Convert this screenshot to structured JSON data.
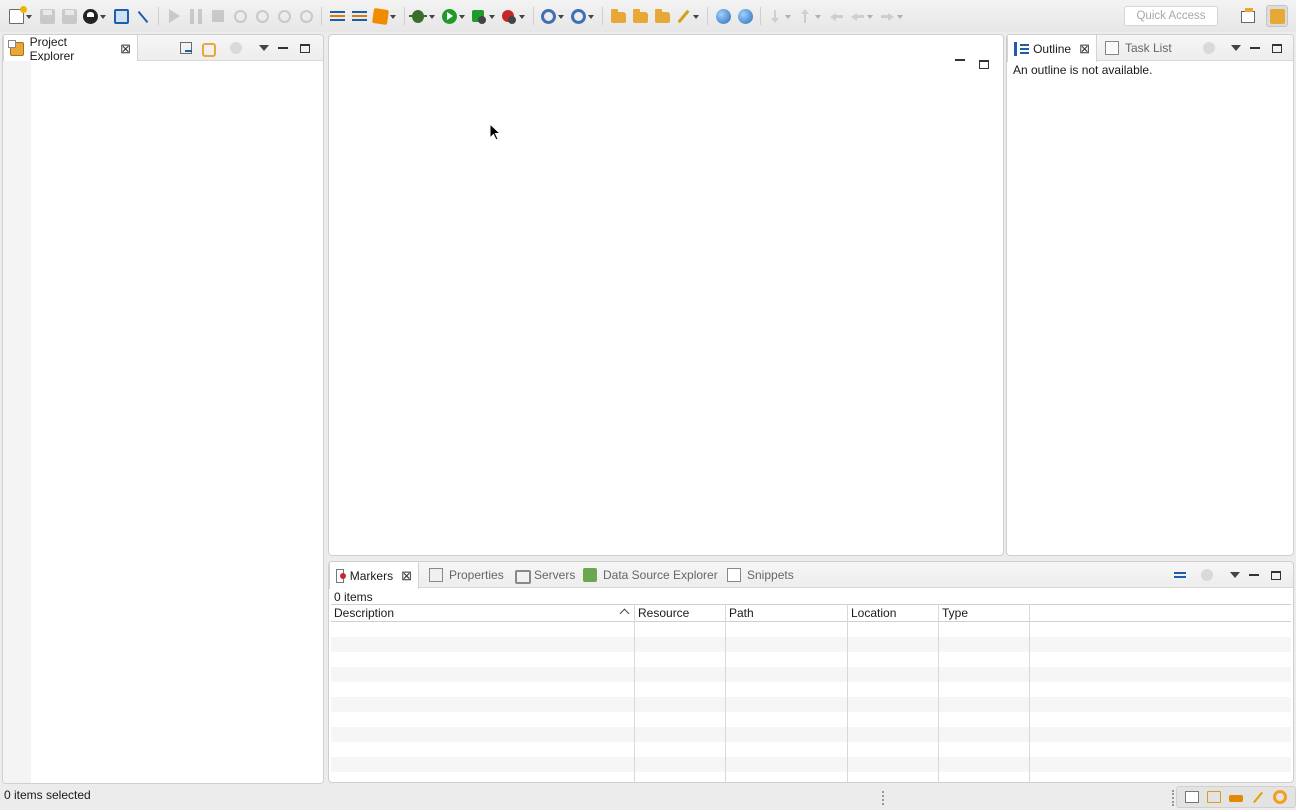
{
  "toolbar": {
    "quick_access_placeholder": "Quick Access",
    "buttons": [
      {
        "name": "new-icon"
      },
      {
        "name": "save-icon"
      },
      {
        "name": "save-all-icon"
      },
      {
        "name": "user-icon"
      },
      {
        "name": "terminal-icon"
      },
      {
        "name": "wand-icon"
      },
      {
        "name": "resume-icon"
      },
      {
        "name": "suspend-icon"
      },
      {
        "name": "terminate-icon"
      },
      {
        "name": "disconnect-icon"
      },
      {
        "name": "step-into-icon"
      },
      {
        "name": "step-over-icon"
      },
      {
        "name": "step-return-icon"
      },
      {
        "name": "task-list-icon"
      },
      {
        "name": "open-type-icon"
      },
      {
        "name": "new-bean-icon"
      },
      {
        "name": "debug-icon"
      },
      {
        "name": "run-icon"
      },
      {
        "name": "coverage-icon"
      },
      {
        "name": "external-tools-icon"
      },
      {
        "name": "new-server-icon"
      },
      {
        "name": "new-wizard-icon"
      },
      {
        "name": "open-folder-icon"
      },
      {
        "name": "open-project-icon"
      },
      {
        "name": "open-file-icon"
      },
      {
        "name": "pencil-icon"
      },
      {
        "name": "globe-icon"
      },
      {
        "name": "search-web-icon"
      },
      {
        "name": "next-annotation-icon"
      },
      {
        "name": "previous-annotation-icon"
      },
      {
        "name": "last-edit-icon"
      },
      {
        "name": "back-icon"
      },
      {
        "name": "forward-icon"
      }
    ]
  },
  "project_explorer": {
    "tab_label": "Project Explorer"
  },
  "outline": {
    "tab_label": "Outline",
    "other_tab_label": "Task List",
    "empty_message": "An outline is not available."
  },
  "markers": {
    "tabs": [
      {
        "label": "Markers",
        "icon": "markers-icon"
      },
      {
        "label": "Properties",
        "icon": "properties-icon"
      },
      {
        "label": "Servers",
        "icon": "servers-icon"
      },
      {
        "label": "Data Source Explorer",
        "icon": "data-source-explorer-icon"
      },
      {
        "label": "Snippets",
        "icon": "snippets-icon"
      }
    ],
    "count_text": "0 items",
    "columns": [
      "Description",
      "Resource",
      "Path",
      "Location",
      "Type"
    ],
    "sort_column": "Description",
    "rows": []
  },
  "statusbar": {
    "text": "0 items selected"
  },
  "colors": {
    "background": "#ececec",
    "panel": "#ffffff",
    "border": "#cfcfcf"
  }
}
